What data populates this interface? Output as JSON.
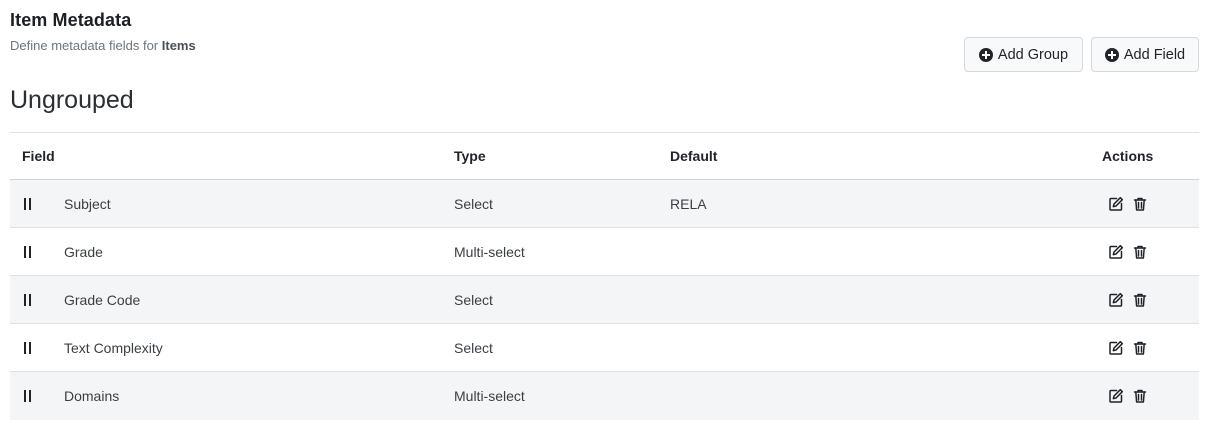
{
  "header": {
    "title": "Item Metadata",
    "subtitle_prefix": "Define metadata fields for",
    "subtitle_entity": "Items"
  },
  "toolbar": {
    "add_group_label": "Add Group",
    "add_field_label": "Add Field"
  },
  "group": {
    "title": "Ungrouped"
  },
  "table": {
    "columns": {
      "field": "Field",
      "type": "Type",
      "default": "Default",
      "actions": "Actions"
    },
    "rows": [
      {
        "field": "Subject",
        "type": "Select",
        "default": "RELA"
      },
      {
        "field": "Grade",
        "type": "Multi-select",
        "default": ""
      },
      {
        "field": "Grade Code",
        "type": "Select",
        "default": ""
      },
      {
        "field": "Text Complexity",
        "type": "Select",
        "default": ""
      },
      {
        "field": "Domains",
        "type": "Multi-select",
        "default": ""
      }
    ]
  },
  "icons": {
    "add": "plus-circle-icon",
    "drag": "drag-handle-icon",
    "edit": "edit-icon",
    "delete": "trash-icon"
  }
}
